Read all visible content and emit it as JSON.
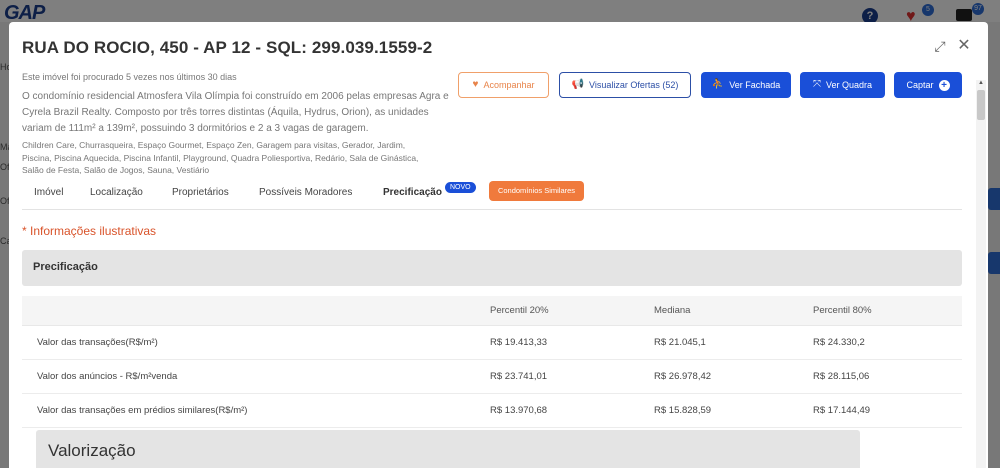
{
  "background": {
    "logo": "GAP",
    "help_icon": "?",
    "favorites_count": "5",
    "cart_count": "97",
    "side_texts": [
      "Ho",
      "Ma",
      "Ofe",
      "Ofe",
      "Ca"
    ]
  },
  "modal": {
    "title": "RUA DO ROCIO, 450 - AP 12 - SQL: 299.039.1559-2",
    "search_note": "Este imóvel foi procurado 5 vezes nos últimos 30 dias",
    "description": "O condomínio residencial Atmosfera Vila Olímpia foi construído em 2006 pelas empresas Agra e Cyrela Brazil Realty. Composto por três torres distintas (Áquila, Hydrus, Orion), as unidades variam de 111m² a 139m², possuindo 3 dormitórios e 2 a 3 vagas de garagem.",
    "amenities": "Children Care, Churrasqueira, Espaço Gourmet, Espaço Zen, Garagem para visitas, Gerador, Jardim, Piscina, Piscina Aquecida, Piscina Infantil, Playground, Quadra Poliesportiva, Redário, Sala de Ginástica, Salão de Festa, Salão de Jogos, Sauna, Vestiário",
    "buttons": {
      "follow": "Acompanhar",
      "offers": "Visualizar Ofertas (52)",
      "facade": "Ver Fachada",
      "block": "Ver Quadra",
      "capture": "Captar"
    },
    "tabs": [
      "Imóvel",
      "Localização",
      "Proprietários",
      "Possíveis Moradores",
      "Precificação"
    ],
    "tab_new_badge": "NOVO",
    "tab_similar": "Condomínios Similares",
    "note": "* Informações ilustrativas",
    "section_title": "Precificação",
    "table": {
      "headers": [
        "",
        "Percentil 20%",
        "Mediana",
        "Percentil 80%"
      ],
      "rows": [
        [
          "Valor das transações(R$/m²)",
          "R$ 19.413,33",
          "R$ 21.045,1",
          "R$ 24.330,2"
        ],
        [
          "Valor dos anúncios - R$/m²venda",
          "R$ 23.741,01",
          "R$ 26.978,42",
          "R$ 28.115,06"
        ],
        [
          "Valor das transações em prédios similares(R$/m²)",
          "R$ 13.970,68",
          "R$ 15.828,59",
          "R$ 17.144,49"
        ]
      ]
    },
    "valorizacao_title": "Valorização"
  },
  "colors": {
    "primary": "#1a4fd8",
    "accent_orange": "#f07a3c",
    "note_red": "#d9532a"
  }
}
